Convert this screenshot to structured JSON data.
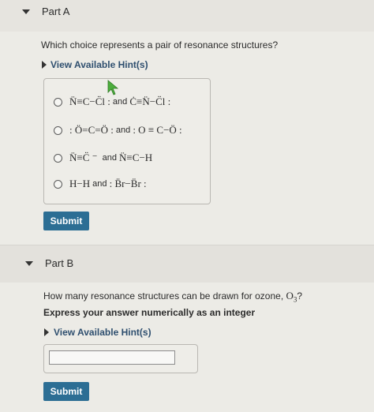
{
  "partA": {
    "title": "Part A",
    "question": "Which choice represents a pair of resonance structures?",
    "hint_label": "View Available Hint(s)",
    "choices": [
      {
        "left": "N̈≡C−C̈l :",
        "sep": " and ",
        "right": "Ċ≡N̈−C̈l :"
      },
      {
        "left": ": Ö=C=Ö :",
        "sep": " and ",
        "right": ": O ≡ C−Ö :"
      },
      {
        "left": "N̈≡C̈ ⁻",
        "sep": "  and ",
        "right": "N̈≡C−H"
      },
      {
        "left": "H−H",
        "sep": " and ",
        "right": ": B̈r−B̈r :"
      }
    ],
    "submit_label": "Submit"
  },
  "partB": {
    "title": "Part B",
    "question": "How many resonance structures can be drawn for ozone, ",
    "ozone_formula": "O",
    "ozone_subscript": "3",
    "question_end": "?",
    "instruction": "Express your answer numerically as an integer",
    "hint_label": "View Available Hint(s)",
    "answer_value": "",
    "submit_label": "Submit"
  }
}
